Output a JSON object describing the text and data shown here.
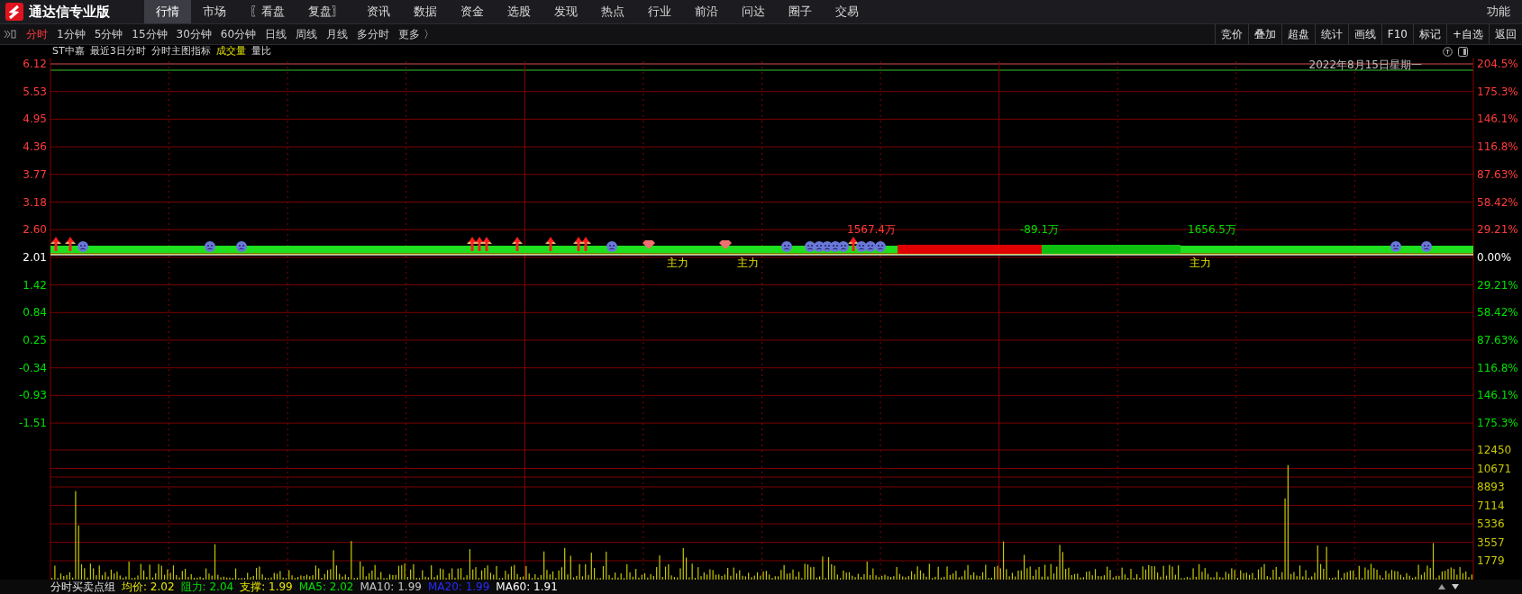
{
  "app": {
    "title": "通达信专业版"
  },
  "menu": [
    {
      "label": "行情",
      "selected": true
    },
    {
      "label": "市场",
      "selected": false
    },
    {
      "label": "〖看盘",
      "selected": false
    },
    {
      "label": "复盘〗",
      "selected": false
    },
    {
      "label": "资讯",
      "selected": false
    },
    {
      "label": "数据",
      "selected": false
    },
    {
      "label": "资金",
      "selected": false
    },
    {
      "label": "选股",
      "selected": false
    },
    {
      "label": "发现",
      "selected": false
    },
    {
      "label": "热点",
      "selected": false
    },
    {
      "label": "行业",
      "selected": false
    },
    {
      "label": "前沿",
      "selected": false
    },
    {
      "label": "问达",
      "selected": false
    },
    {
      "label": "圈子",
      "selected": false
    },
    {
      "label": "交易",
      "selected": false
    }
  ],
  "menu_right": "功能",
  "periods": [
    {
      "label": "分时",
      "selected": true
    },
    {
      "label": "1分钟",
      "selected": false
    },
    {
      "label": "5分钟",
      "selected": false
    },
    {
      "label": "15分钟",
      "selected": false
    },
    {
      "label": "30分钟",
      "selected": false
    },
    {
      "label": "60分钟",
      "selected": false
    },
    {
      "label": "日线",
      "selected": false
    },
    {
      "label": "周线",
      "selected": false
    },
    {
      "label": "月线",
      "selected": false
    },
    {
      "label": "多分时",
      "selected": false
    },
    {
      "label": "更多 〉",
      "selected": false
    }
  ],
  "tools": [
    "竞价",
    "叠加",
    "超盘",
    "统计",
    "画线",
    "F10",
    "标记",
    "+自选",
    "返回"
  ],
  "chart": {
    "stock": "ST中嘉",
    "range": "最近3日分时",
    "indicator": "分时主图指标",
    "volume_label": "成交量",
    "ratio_label": "量比",
    "date": "2022年8月15日星期一",
    "price_ticks": [
      {
        "price": "6.12",
        "change": "204.5%",
        "kind": "up"
      },
      {
        "price": "5.53",
        "change": "175.3%",
        "kind": "up"
      },
      {
        "price": "4.95",
        "change": "146.1%",
        "kind": "up"
      },
      {
        "price": "4.36",
        "change": "116.8%",
        "kind": "up"
      },
      {
        "price": "3.77",
        "change": "87.63%",
        "kind": "up"
      },
      {
        "price": "3.18",
        "change": "58.42%",
        "kind": "up"
      },
      {
        "price": "2.60",
        "change": "29.21%",
        "kind": "up"
      },
      {
        "price": "2.01",
        "change": "0.00%",
        "kind": "flat"
      },
      {
        "price": "1.42",
        "change": "29.21%",
        "kind": "down"
      },
      {
        "price": "0.84",
        "change": "58.42%",
        "kind": "down"
      },
      {
        "price": "0.25",
        "change": "87.63%",
        "kind": "down"
      },
      {
        "price": "-0.34",
        "change": "116.8%",
        "kind": "down"
      },
      {
        "price": "-0.93",
        "change": "146.1%",
        "kind": "down"
      },
      {
        "price": "-1.51",
        "change": "175.3%",
        "kind": "down"
      }
    ],
    "flow_labels": [
      {
        "text": "1567.4万",
        "kind": "up"
      },
      {
        "text": "-89.1万",
        "kind": "down"
      },
      {
        "text": "1656.5万",
        "kind": "down"
      }
    ],
    "main_force_labels": [
      "主力",
      "主力",
      "主力"
    ],
    "volume_ticks": [
      "12450",
      "10671",
      "8893",
      "7114",
      "5336",
      "3557",
      "1779"
    ]
  },
  "status": {
    "title": "分时买卖点组",
    "values": [
      {
        "text": "均价: 2.02",
        "color": "#e6e600"
      },
      {
        "text": "阻力: 2.04",
        "color": "#00e000"
      },
      {
        "text": "支撑: 1.99",
        "color": "#e6e600"
      },
      {
        "text": "MA5: 2.02",
        "color": "#00e000"
      },
      {
        "text": "MA10: 1.99",
        "color": "#c8c8c8"
      },
      {
        "text": "MA20: 1.99",
        "color": "#2a2aff"
      },
      {
        "text": "MA60: 1.91",
        "color": "#ffffff"
      }
    ]
  }
}
